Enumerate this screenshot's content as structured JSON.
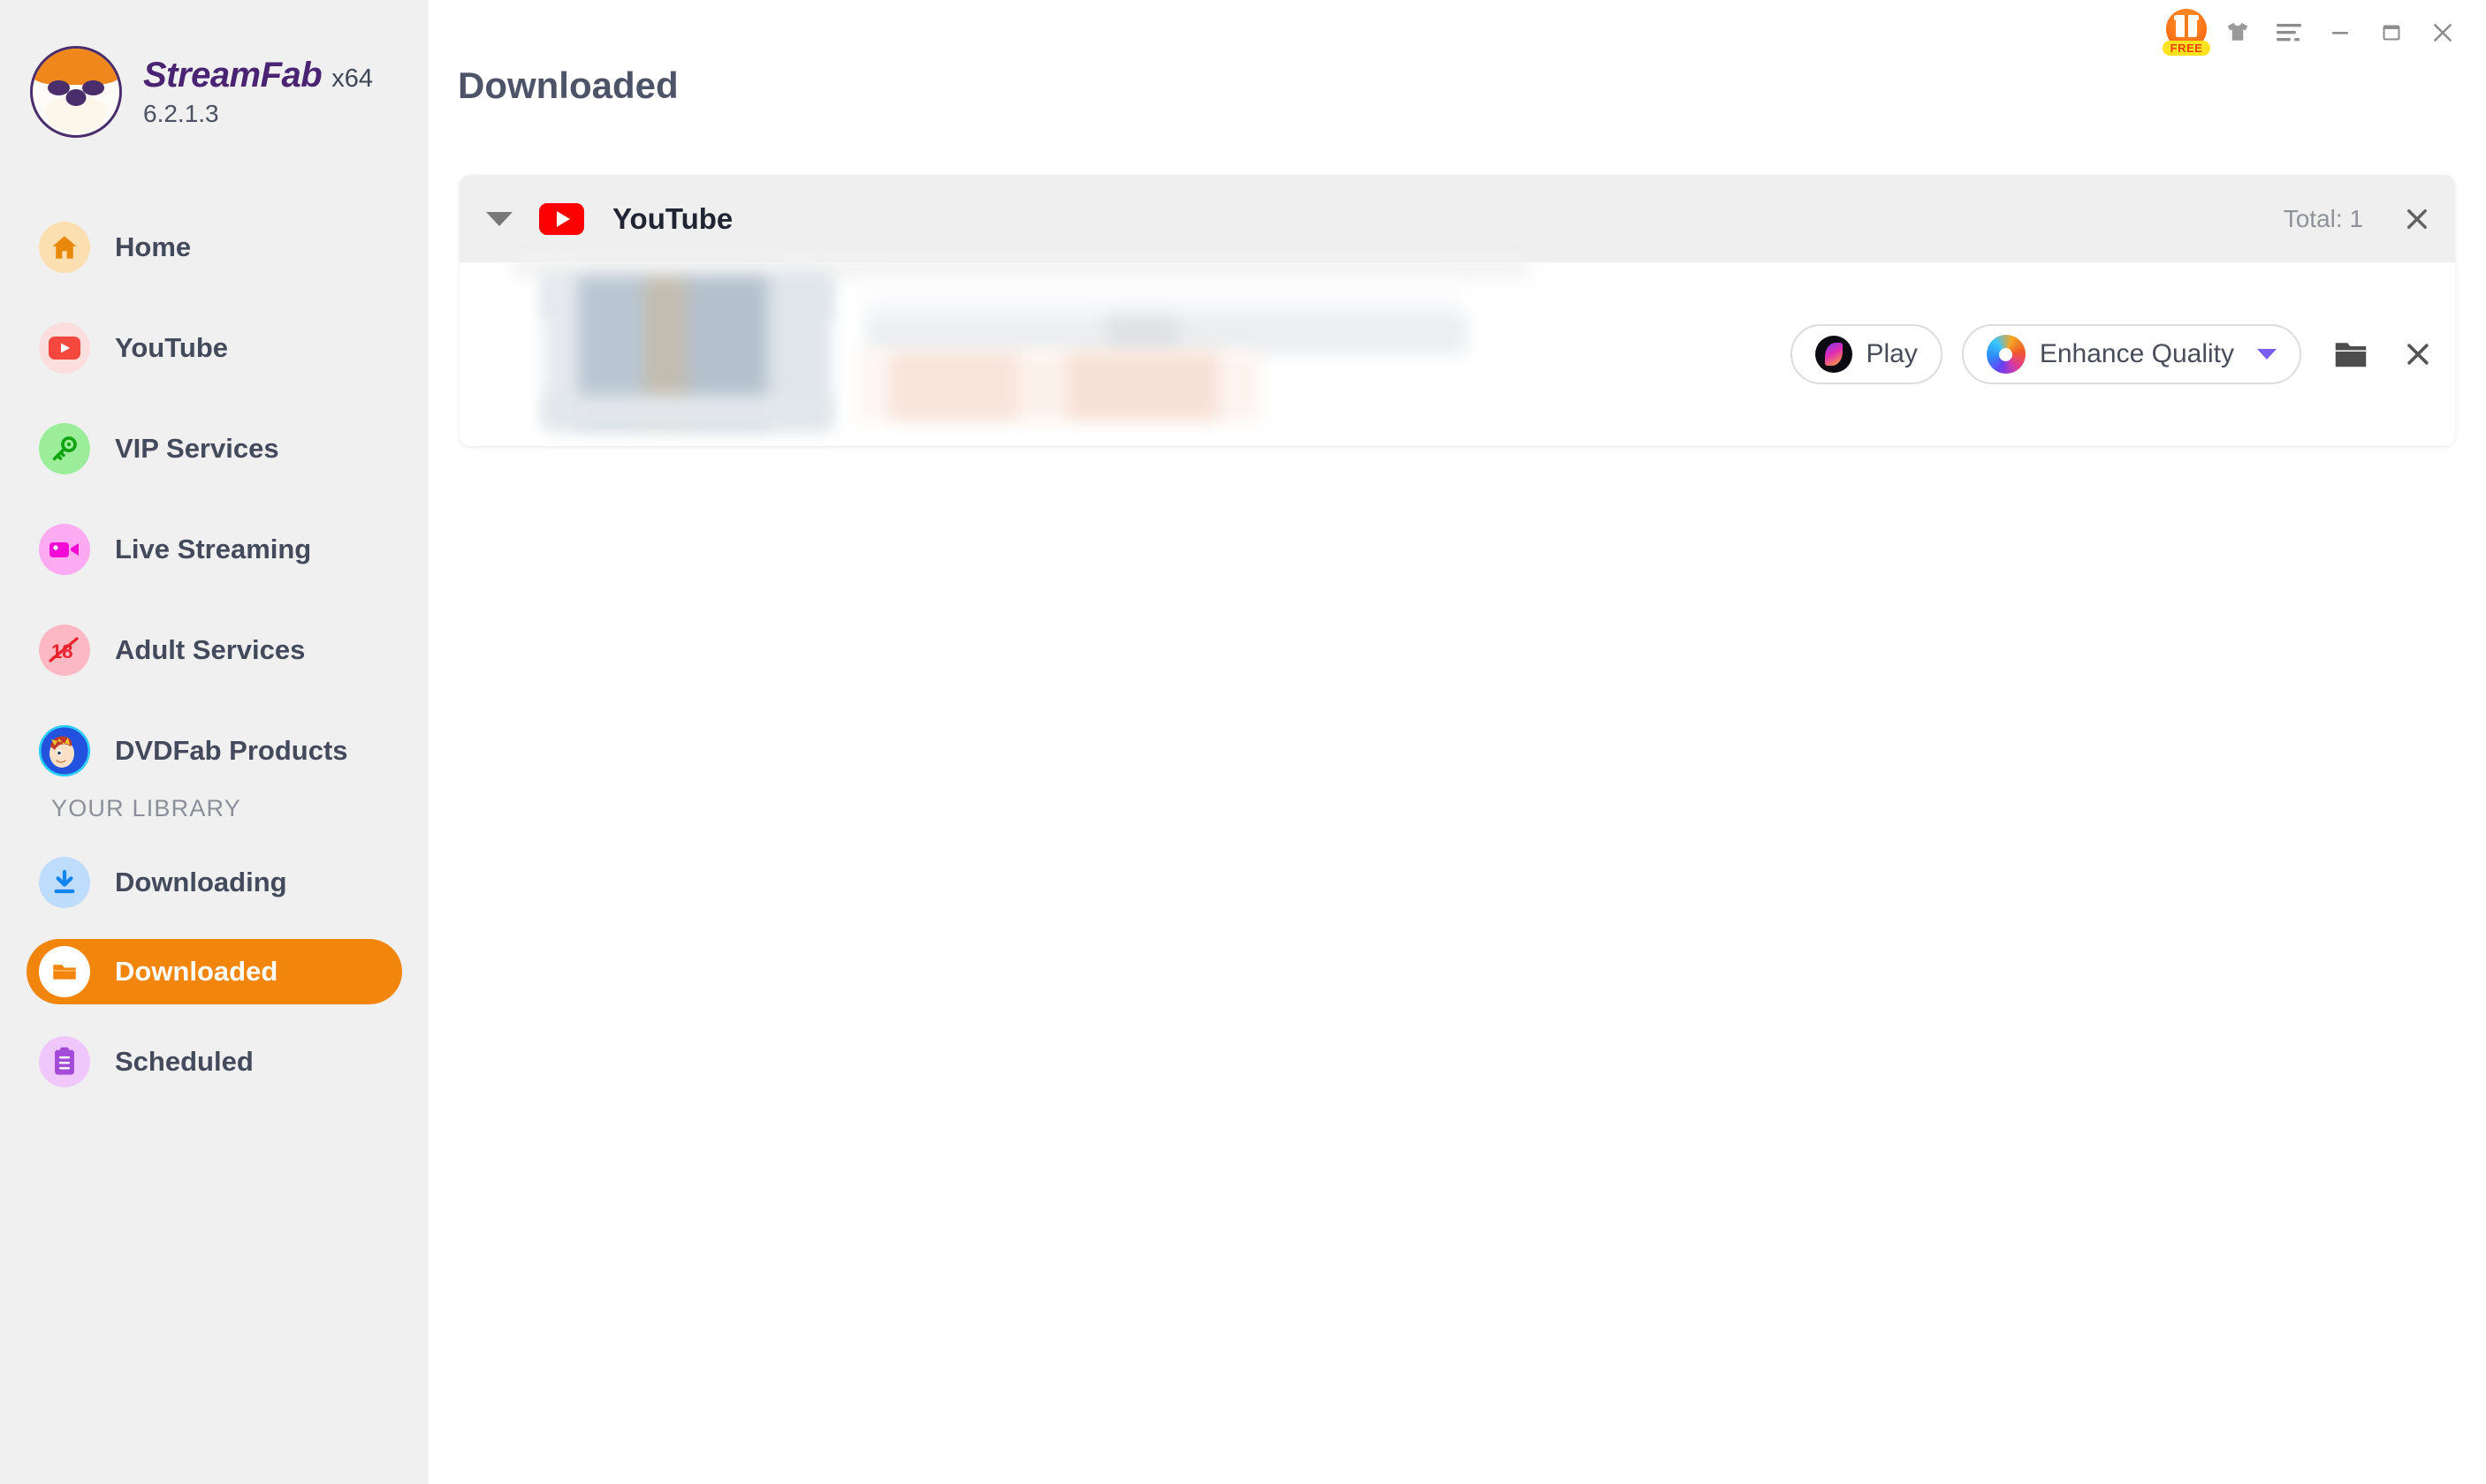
{
  "app": {
    "brand_name": "StreamFab",
    "architecture": "x64",
    "version": "6.2.1.3",
    "accent_color": "#f2860d"
  },
  "titlebar": {
    "gift_badge_label": "FREE",
    "items": [
      {
        "name": "gift-free-badge",
        "label": "FREE"
      },
      {
        "name": "tshirt-icon",
        "label": ""
      },
      {
        "name": "menu-icon",
        "label": ""
      },
      {
        "name": "minimize-button",
        "label": ""
      },
      {
        "name": "maximize-button",
        "label": ""
      },
      {
        "name": "close-button",
        "label": ""
      }
    ]
  },
  "sidebar": {
    "items": [
      {
        "label": "Home",
        "icon": "home-icon",
        "bg": "#fcdfb0",
        "fg": "#e8890b"
      },
      {
        "label": "YouTube",
        "icon": "youtube-icon",
        "bg": "#fbdedd",
        "fg": "#f4473d"
      },
      {
        "label": "VIP Services",
        "icon": "key-icon",
        "bg": "#9ced9a",
        "fg": "#12a312"
      },
      {
        "label": "Live Streaming",
        "icon": "video-camera-icon",
        "bg": "#fcaaf2",
        "fg": "#f20ad6"
      },
      {
        "label": "Adult Services",
        "icon": "no-18-plus-icon",
        "bg": "#fcb9c4",
        "fg": "#e8222d"
      },
      {
        "label": "DVDFab Products",
        "icon": "dvdfab-mascot-icon",
        "bg": "#2a5fe8",
        "fg": "#ffffff"
      }
    ],
    "library_header": "YOUR LIBRARY",
    "library_items": [
      {
        "label": "Downloading",
        "icon": "download-arrow-icon",
        "bg": "#bedcfc",
        "fg": "#1184f0",
        "active": false
      },
      {
        "label": "Downloaded",
        "icon": "open-folder-icon",
        "bg": "#ffffff",
        "fg": "#f2860d",
        "active": true
      },
      {
        "label": "Scheduled",
        "icon": "clipboard-icon",
        "bg": "#f0c7fc",
        "fg": "#a34ad6",
        "active": false
      }
    ]
  },
  "main": {
    "page_title": "Downloaded",
    "group": {
      "service": "YouTube",
      "service_icon": "youtube-icon",
      "collapse_icon": "chevron-down-icon",
      "total_label": "Total: 1",
      "close_icon": "close-icon"
    },
    "row": {
      "thumbnail": "censored-thumbnail",
      "title": "censored-title",
      "subtitle": "censored-subtitle",
      "meta": "censored-meta",
      "play_label": "Play",
      "play_icon": "play-orb-icon",
      "enhance_label": "Enhance Quality",
      "enhance_icon": "enhance-orb-icon",
      "enhance_caret_icon": "chevron-down-icon",
      "folder_icon": "folder-icon",
      "close_icon": "close-icon"
    }
  }
}
